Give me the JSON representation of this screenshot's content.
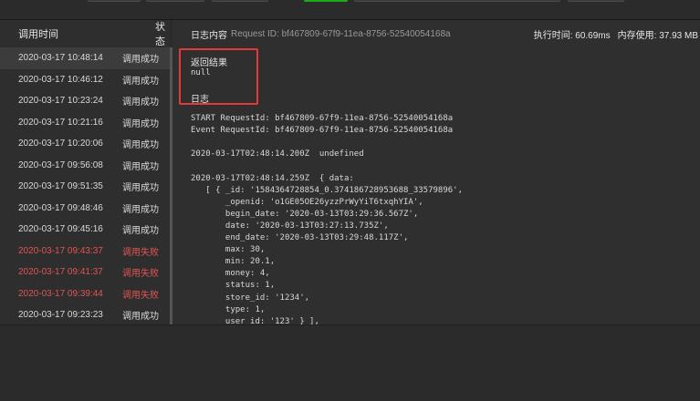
{
  "left_panel": {
    "col_time": "调用时间",
    "col_status": "状态",
    "rows": [
      {
        "time": "2020-03-17 10:48:14",
        "status": "调用成功",
        "fail": false,
        "selected": true
      },
      {
        "time": "2020-03-17 10:46:12",
        "status": "调用成功",
        "fail": false
      },
      {
        "time": "2020-03-17 10:23:24",
        "status": "调用成功",
        "fail": false
      },
      {
        "time": "2020-03-17 10:21:16",
        "status": "调用成功",
        "fail": false
      },
      {
        "time": "2020-03-17 10:20:06",
        "status": "调用成功",
        "fail": false
      },
      {
        "time": "2020-03-17 09:56:08",
        "status": "调用成功",
        "fail": false
      },
      {
        "time": "2020-03-17 09:51:35",
        "status": "调用成功",
        "fail": false
      },
      {
        "time": "2020-03-17 09:48:46",
        "status": "调用成功",
        "fail": false
      },
      {
        "time": "2020-03-17 09:45:16",
        "status": "调用成功",
        "fail": false
      },
      {
        "time": "2020-03-17 09:43:37",
        "status": "调用失败",
        "fail": true
      },
      {
        "time": "2020-03-17 09:41:37",
        "status": "调用失败",
        "fail": true
      },
      {
        "time": "2020-03-17 09:39:44",
        "status": "调用失败",
        "fail": true
      },
      {
        "time": "2020-03-17 09:23:23",
        "status": "调用成功",
        "fail": false
      }
    ]
  },
  "log_header": {
    "title": "日志内容",
    "request_id": "Request ID: bf467809-67f9-11ea-8756-52540054168a",
    "exec_time": "执行时间: 60.69ms",
    "memory": "内存使用: 37.93 MB"
  },
  "log_body": {
    "return_title": "返回结果",
    "return_value": "null",
    "log_title": "日志",
    "lines": [
      "START RequestId: bf467809-67f9-11ea-8756-52540054168a",
      "Event RequestId: bf467809-67f9-11ea-8756-52540054168a",
      "",
      "2020-03-17T02:48:14.200Z  undefined",
      "",
      "2020-03-17T02:48:14.259Z  { data:",
      "   [ { _id: '1584364728854_0.374186728953688_33579896',",
      "       _openid: 'o1GE05OE26yzzPrWyYiT6txqhYIA',",
      "       begin_date: '2020-03-13T03:29:36.567Z',",
      "       date: '2020-03-13T03:27:13.735Z',",
      "       end_date: '2020-03-13T03:29:48.117Z',",
      "       max: 30,",
      "       min: 20.1,",
      "       money: 4,",
      "       status: 1,",
      "       store_id: '1234',",
      "       type: 1,",
      "       user_id: '123' } ],"
    ]
  },
  "colors": {
    "success": "#d9d9d9",
    "fail": "#e05454",
    "highlight_box": "#e23a3a"
  }
}
